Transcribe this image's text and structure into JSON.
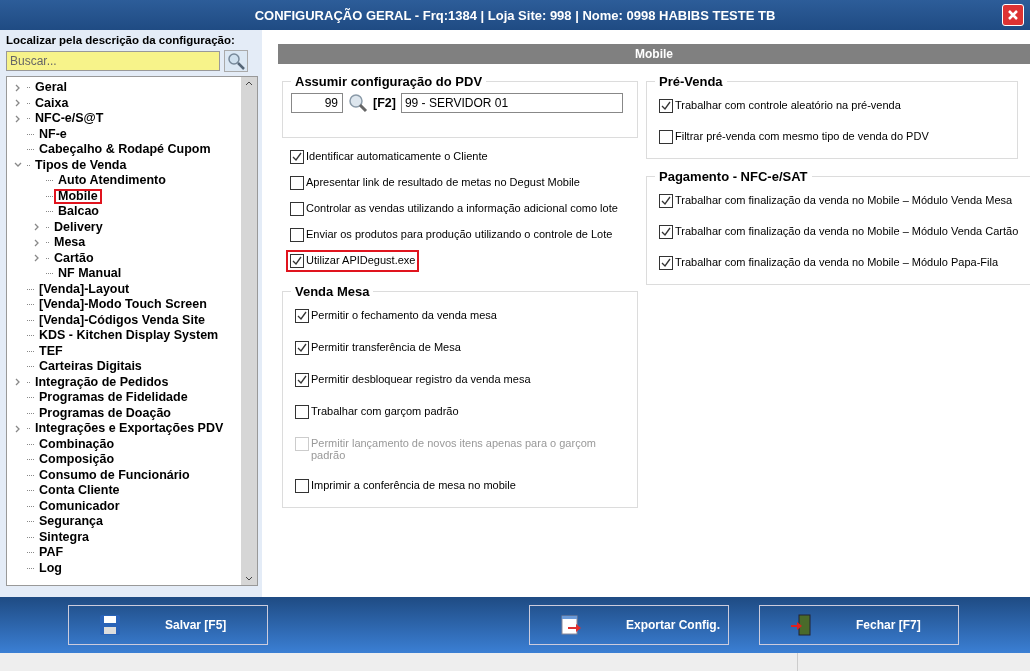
{
  "window": {
    "title": "CONFIGURAÇÃO GERAL - Frq:1384 | Loja Site: 998 | Nome: 0998 HABIBS TESTE TB"
  },
  "sidebar": {
    "search_label": "Localizar pela descrição da configuração:",
    "search": {
      "placeholder": "Buscar..."
    },
    "tree": [
      {
        "label": "Geral",
        "kind": "group",
        "expanded": false,
        "highlighted": false
      },
      {
        "label": "Caixa",
        "kind": "group",
        "expanded": false,
        "highlighted": false
      },
      {
        "label": "NFC-e/S@T",
        "kind": "group",
        "expanded": false,
        "highlighted": false
      },
      {
        "label": "NF-e",
        "kind": "leaf",
        "highlighted": false
      },
      {
        "label": "Cabeçalho & Rodapé Cupom",
        "kind": "leaf",
        "highlighted": false
      },
      {
        "label": "Tipos de Venda",
        "kind": "group",
        "expanded": true,
        "highlighted": false,
        "children": [
          {
            "label": "Auto Atendimento",
            "kind": "leaf",
            "highlighted": false
          },
          {
            "label": "Mobile",
            "kind": "leaf",
            "highlighted": true
          },
          {
            "label": "Balcao",
            "kind": "leaf",
            "highlighted": false
          },
          {
            "label": "Delivery",
            "kind": "group",
            "expanded": false,
            "highlighted": false
          },
          {
            "label": "Mesa",
            "kind": "group",
            "expanded": false,
            "highlighted": false
          },
          {
            "label": "Cartão",
            "kind": "group",
            "expanded": false,
            "highlighted": false
          },
          {
            "label": "NF Manual",
            "kind": "leaf",
            "highlighted": false
          }
        ]
      },
      {
        "label": "[Venda]-Layout",
        "kind": "leaf",
        "highlighted": false
      },
      {
        "label": "[Venda]-Modo Touch Screen",
        "kind": "leaf",
        "highlighted": false
      },
      {
        "label": "[Venda]-Códigos Venda Site",
        "kind": "leaf",
        "highlighted": false
      },
      {
        "label": "KDS - Kitchen Display System",
        "kind": "leaf",
        "highlighted": false
      },
      {
        "label": "TEF",
        "kind": "leaf",
        "highlighted": false
      },
      {
        "label": "Carteiras Digitais",
        "kind": "leaf",
        "highlighted": false
      },
      {
        "label": "Integração de Pedidos",
        "kind": "group",
        "expanded": false,
        "highlighted": false
      },
      {
        "label": "Programas de Fidelidade",
        "kind": "leaf",
        "highlighted": false
      },
      {
        "label": "Programas de Doação",
        "kind": "leaf",
        "highlighted": false
      },
      {
        "label": "Integrações e Exportações PDV",
        "kind": "group",
        "expanded": false,
        "highlighted": false
      },
      {
        "label": "Combinação",
        "kind": "leaf",
        "highlighted": false
      },
      {
        "label": "Composição",
        "kind": "leaf",
        "highlighted": false
      },
      {
        "label": "Consumo de Funcionário",
        "kind": "leaf",
        "highlighted": false
      },
      {
        "label": "Conta Cliente",
        "kind": "leaf",
        "highlighted": false
      },
      {
        "label": "Comunicador",
        "kind": "leaf",
        "highlighted": false
      },
      {
        "label": "Segurança",
        "kind": "leaf",
        "highlighted": false
      },
      {
        "label": "Sintegra",
        "kind": "leaf",
        "highlighted": false
      },
      {
        "label": "PAF",
        "kind": "leaf",
        "highlighted": false
      },
      {
        "label": "Log",
        "kind": "leaf",
        "highlighted": false
      }
    ]
  },
  "panel": {
    "title": "Mobile",
    "pdv": {
      "title": "Assumir configuração do PDV",
      "code": "99",
      "shortcut": "[F2]",
      "name": "99 - SERVIDOR 01"
    },
    "options": [
      {
        "label": "Identificar automaticamente o Cliente",
        "checked": true,
        "highlighted": false
      },
      {
        "label": "Apresentar link de resultado de metas no Degust Mobile",
        "checked": false,
        "highlighted": false
      },
      {
        "label": "Controlar as vendas utilizando a informação adicional como lote",
        "checked": false,
        "highlighted": false
      },
      {
        "label": "Enviar os produtos para produção utilizando o controle de Lote",
        "checked": false,
        "highlighted": false
      },
      {
        "label": "Utilizar APIDegust.exe",
        "checked": true,
        "highlighted": true
      }
    ],
    "venda_mesa": {
      "title": "Venda Mesa",
      "options": [
        {
          "label": "Permitir o fechamento da venda mesa",
          "checked": true,
          "disabled": false
        },
        {
          "label": "Permitir transferência de Mesa",
          "checked": true,
          "disabled": false
        },
        {
          "label": "Permitir desbloquear registro da venda mesa",
          "checked": true,
          "disabled": false
        },
        {
          "label": "Trabalhar com garçom padrão",
          "checked": false,
          "disabled": false
        },
        {
          "label": "Permitir lançamento de novos itens apenas para o garçom padrão",
          "checked": false,
          "disabled": true
        },
        {
          "label": "Imprimir a conferência de mesa no mobile",
          "checked": false,
          "disabled": false
        }
      ]
    },
    "pre_venda": {
      "title": "Pré-Venda",
      "options": [
        {
          "label": "Trabalhar com controle aleatório na pré-venda",
          "checked": true
        },
        {
          "label": "Filtrar pré-venda com mesmo tipo de venda do PDV",
          "checked": false
        }
      ]
    },
    "pagamento": {
      "title": "Pagamento - NFC-e/SAT",
      "options": [
        {
          "label": "Trabalhar com finalização da venda no Mobile – Módulo Venda Mesa",
          "checked": true
        },
        {
          "label": "Trabalhar com finalização da venda no Mobile – Módulo Venda Cartão",
          "checked": true
        },
        {
          "label": "Trabalhar com finalização da venda no Mobile – Módulo Papa-Fila",
          "checked": true
        }
      ]
    }
  },
  "buttons": [
    {
      "label": "Salvar [F5]",
      "kind": "save"
    },
    {
      "label": "Exportar Config.",
      "kind": "export"
    },
    {
      "label": "Fechar [F7]",
      "kind": "close"
    }
  ]
}
